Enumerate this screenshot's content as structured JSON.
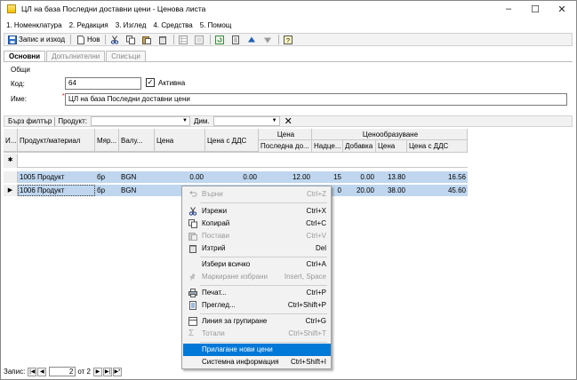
{
  "window": {
    "title": "ЦЛ на база Последни доставни цени - Ценова листа"
  },
  "menu": [
    "1. Номенклатура",
    "2. Редакция",
    "3. Изглед",
    "4. Средства",
    "5. Помощ"
  ],
  "toolbar": {
    "save_exit": "Запис и изход",
    "new": "Нов"
  },
  "tabs": [
    "Основни",
    "Допълнителни",
    "Списъци"
  ],
  "form": {
    "group": "Общи",
    "code_label": "Код:",
    "code_value": "64",
    "active_label": "Активна",
    "active_checked": "✓",
    "name_label": "Име:",
    "name_required": "*",
    "name_value": "ЦЛ на база Последни доставни цени"
  },
  "filter": {
    "quick": "Бърз филтър",
    "product": "Продукт:",
    "dim": "Дим."
  },
  "grid": {
    "h_indicator": "И...",
    "h_product": "Продукт/материал",
    "h_unit": "Мяр...",
    "h_currency": "Валу...",
    "h_price": "Цена",
    "h_price_vat": "Цена с ДДС",
    "h_group_price": "Цена",
    "h_last_delivery": "Последна до...",
    "h_group_pricing": "Ценообразуване",
    "h_markup": "Надце...",
    "h_addition": "Добавка",
    "h_price2": "Цена",
    "h_price_vat2": "Цена с ДДС",
    "new_row_marker": "✱",
    "rows": [
      {
        "product": "1005 Продукт",
        "unit": "бр",
        "currency": "BGN",
        "price": "0.00",
        "price_vat": "0.00",
        "last": "12.00",
        "markup": "15",
        "add": "0.00",
        "price2": "13.80",
        "price_vat2": "16.56"
      },
      {
        "product": "1006 Продукт",
        "unit": "бр",
        "currency": "BGN",
        "price": "",
        "price_vat": "",
        "last": "",
        "markup": "0",
        "add": "20.00",
        "price2": "38.00",
        "price_vat2": "45.60"
      }
    ]
  },
  "nav": {
    "record_label": "Запис:",
    "current": "2",
    "of_label": "от 2"
  },
  "context_menu": [
    {
      "label": "Върни",
      "shortcut": "Ctrl+Z",
      "disabled": true
    },
    {
      "label": "Изрежи",
      "shortcut": "Ctrl+X"
    },
    {
      "label": "Копирай",
      "shortcut": "Ctrl+C"
    },
    {
      "label": "Постави",
      "shortcut": "Ctrl+V",
      "disabled": true
    },
    {
      "label": "Изтрий",
      "shortcut": "Del"
    },
    {
      "label": "Избери всичко",
      "shortcut": "Ctrl+A"
    },
    {
      "label": "Маркиране избрани",
      "shortcut": "Insert, Space",
      "disabled": true
    },
    {
      "label": "Печат...",
      "shortcut": "Ctrl+P"
    },
    {
      "label": "Преглед...",
      "shortcut": "Ctrl+Shift+P"
    },
    {
      "label": "Линия за групиране",
      "shortcut": "Ctrl+G"
    },
    {
      "label": "Тотали",
      "shortcut": "Ctrl+Shift+T",
      "disabled": true
    },
    {
      "label": "Прилагане нови цени",
      "shortcut": "",
      "highlighted": true
    },
    {
      "label": "Системна информация",
      "shortcut": "Ctrl+Shift+I"
    }
  ],
  "colors": {
    "selection": "#bfd6ee",
    "highlight": "#0078d7",
    "accent": "#1f5fb4"
  }
}
